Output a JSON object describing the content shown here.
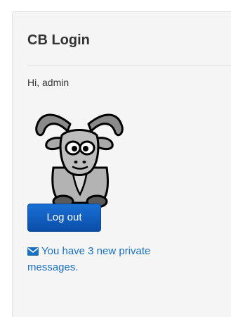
{
  "module": {
    "title": "CB Login",
    "greeting": "Hi, admin",
    "avatar_alt": "goat-avatar",
    "logout_label": "Log out",
    "messages_text": "You have 3 new private messages.",
    "messages_icon": "envelope-icon",
    "accent_color": "#1a71c2",
    "button_color": "#0a56b8"
  }
}
